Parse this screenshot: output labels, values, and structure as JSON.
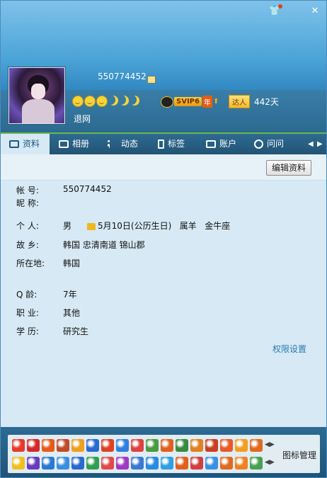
{
  "window": {
    "skin_icon": "shirt-icon",
    "close_icon": "close-icon",
    "close_label": "✕"
  },
  "profile": {
    "qq_number": "550774452",
    "status": "退网",
    "level_icons": [
      "sun",
      "sun",
      "sun",
      "moon",
      "moon",
      "moon"
    ],
    "svip_badge": "SVIP6",
    "svip_year": "年",
    "daren_badge": "达人",
    "online_days": "442天"
  },
  "tabs": [
    {
      "label": "资料",
      "icon": "card-icon",
      "active": true
    },
    {
      "label": "相册",
      "icon": "photo-icon",
      "active": false
    },
    {
      "label": "动态",
      "icon": "list-icon",
      "active": false
    },
    {
      "label": "标签",
      "icon": "bookmark-icon",
      "active": false
    },
    {
      "label": "账户",
      "icon": "wallet-icon",
      "active": false
    },
    {
      "label": "问问",
      "icon": "question-icon",
      "active": false
    }
  ],
  "toolbar": {
    "edit_label": "编辑资料"
  },
  "info": {
    "account_label": "帐      号:",
    "account_value": "550774452",
    "nickname_label": "昵      称:",
    "nickname_value": "",
    "personal_label": "个      人:",
    "gender": "男",
    "birthday": "5月10日(公历生日)",
    "zodiac": "属羊",
    "constellation": "金牛座",
    "hometown_label": "故      乡:",
    "hometown_value": "韩国 忠清南道 锦山郡",
    "location_label": "所在地:",
    "location_value": "韩国",
    "age_label": "Q      龄:",
    "age_value": "7年",
    "job_label": "职      业:",
    "job_value": "其他",
    "edu_label": "学      历:",
    "edu_value": "研究生",
    "permission_link": "权限设置"
  },
  "icon_bar": {
    "manage_label": "图标管理",
    "row1_colors": [
      "#e83a2a",
      "#d42a2a",
      "#e85a1a",
      "#c04a2a",
      "#f0a020",
      "#2a6ad0",
      "#e04020",
      "#3080e0",
      "#e04040",
      "#4a9a40",
      "#e06020",
      "#3a8a40",
      "#e08020",
      "#c84020",
      "#e85a2a",
      "#f0a020",
      "#e06a20"
    ],
    "row2_colors": [
      "#f0c020",
      "#6a3ac0",
      "#2a7ad0",
      "#3a90e0",
      "#2a6ad0",
      "#30a050",
      "#e04a4a",
      "#a03ac0",
      "#3a7ad0",
      "#2a8ae0",
      "#30a0e0",
      "#e06020",
      "#d04040",
      "#3a90e0",
      "#e06a20",
      "#f08020",
      "#4aa050"
    ]
  }
}
